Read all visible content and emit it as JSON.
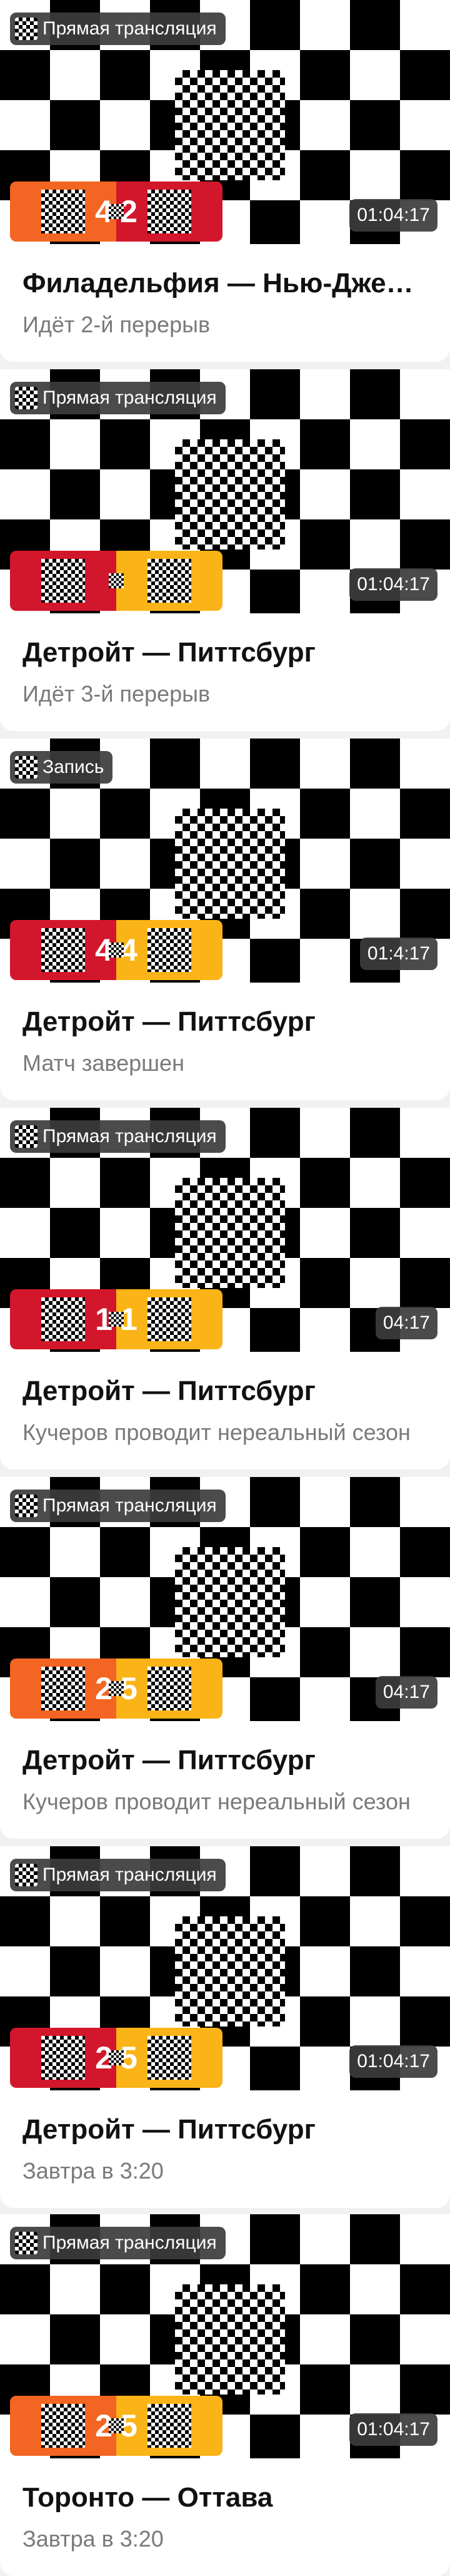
{
  "colors": {
    "team_red": "#d2172c",
    "team_orange": "#f26522",
    "team_yellow": "#fbb417",
    "badge_bg": "#3c3c3c",
    "subtitle": "#7a7a7a"
  },
  "cards": [
    {
      "badge": "Прямая трансляция",
      "duration": "01:04:17",
      "score_home": "4",
      "score_away": "2",
      "color_home": "#f26522",
      "color_away": "#d2172c",
      "title": "Филадельфия — Нью-Джерси",
      "subtitle": "Идёт 2-й перерыв"
    },
    {
      "badge": "Прямая трансляция",
      "duration": "01:04:17",
      "score_home": "",
      "score_away": "",
      "color_home": "#d2172c",
      "color_away": "#fbb417",
      "title": "Детройт — Питтсбург",
      "subtitle": "Идёт 3-й перерыв"
    },
    {
      "badge": "Запись",
      "duration": "01:4:17",
      "score_home": "4",
      "score_away": "4",
      "color_home": "#d2172c",
      "color_away": "#fbb417",
      "title": "Детройт — Питтсбург",
      "subtitle": "Матч завершен"
    },
    {
      "badge": "Прямая трансляция",
      "duration": "04:17",
      "score_home": "1",
      "score_away": "1",
      "color_home": "#d2172c",
      "color_away": "#fbb417",
      "title": "Детройт — Питтсбург",
      "subtitle": "Кучеров проводит нереальный сезон"
    },
    {
      "badge": "Прямая трансляция",
      "duration": "04:17",
      "score_home": "2",
      "score_away": "5",
      "color_home": "#f26522",
      "color_away": "#fbb417",
      "title": "Детройт — Питтсбург",
      "subtitle": "Кучеров проводит нереальный сезон"
    },
    {
      "badge": "Прямая трансляция",
      "duration": "01:04:17",
      "score_home": "2",
      "score_away": "5",
      "color_home": "#d2172c",
      "color_away": "#fbb417",
      "title": "Детройт — Питтсбург",
      "subtitle": "Завтра в 3:20"
    },
    {
      "badge": "Прямая трансляция",
      "duration": "01:04:17",
      "score_home": "2",
      "score_away": "5",
      "color_home": "#f26522",
      "color_away": "#fbb417",
      "title": "Торонто — Оттава",
      "subtitle": "Завтра в 3:20"
    }
  ]
}
